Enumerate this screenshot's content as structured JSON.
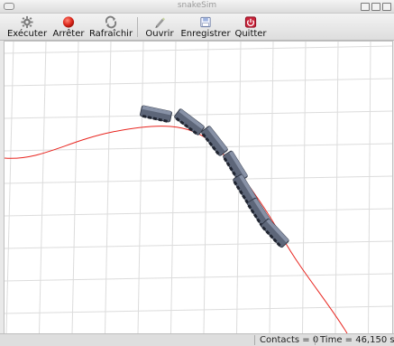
{
  "window": {
    "title": "snakeSim"
  },
  "toolbar": {
    "run_label": "Exécuter",
    "stop_label": "Arrêter",
    "refresh_label": "Rafraîchir",
    "open_label": "Ouvrir",
    "save_label": "Enregistrer",
    "quit_label": "Quitter",
    "icons": [
      "gear-icon",
      "stop-icon",
      "refresh-icon",
      "open-icon",
      "save-icon",
      "quit-icon"
    ]
  },
  "simulation": {
    "path_color": "#e8241e",
    "robot_color": "#5d6679",
    "grid_color": "#dcdcdc",
    "segment_count": 7
  },
  "status": {
    "contacts": "Contacts = 0",
    "time": "Time = 46,150 s"
  }
}
